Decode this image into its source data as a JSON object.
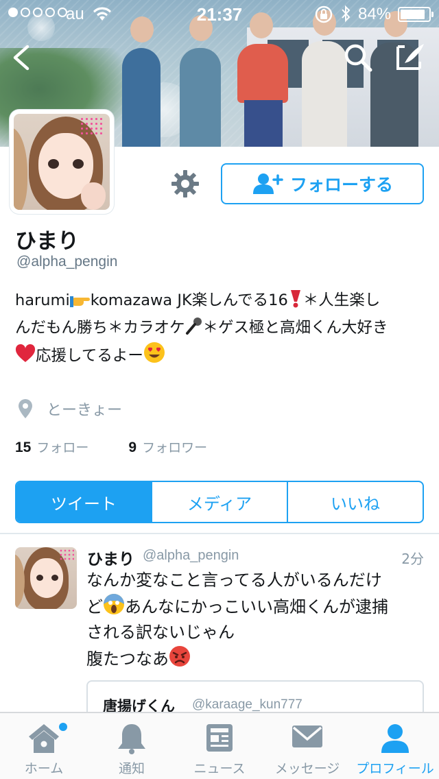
{
  "status_bar": {
    "carrier": "au",
    "time": "21:37",
    "battery_percent": "84%",
    "signal_bars_filled": 1,
    "signal_bars_total": 5,
    "battery_level": 0.84
  },
  "header_icons": [
    "back-icon",
    "search-icon",
    "compose-icon"
  ],
  "profile": {
    "display_name": "ひまり",
    "handle": "@alpha_pengin",
    "bio_line1": "harumi",
    "bio_line1b": "komazawa JK楽しんでる16",
    "bio_line1c": "＊人生楽し",
    "bio_line2": "んだもん勝ち＊カラオケ",
    "bio_line2b": "＊ゲス極と高畑くん大好き",
    "bio_line3": "応援してるよー",
    "location": "とーきょー",
    "following_count": "15",
    "following_label": "フォロー",
    "followers_count": "9",
    "followers_label": "フォロワー"
  },
  "actions": {
    "follow_label": "フォローする"
  },
  "tabs": [
    {
      "label": "ツイート",
      "active": true
    },
    {
      "label": "メディア",
      "active": false
    },
    {
      "label": "いいね",
      "active": false
    }
  ],
  "tweet": {
    "name": "ひまり",
    "handle": "@alpha_pengin",
    "time": "2分",
    "line1": "なんか変なこと言ってる人がいるんだけ",
    "line2a": "ど",
    "line2b": "あんなにかっこいい高畑くんが逮捕",
    "line3": "される訳ないじゃん",
    "line4": "腹たつなあ",
    "quote_name": "唐揚げくん",
    "quote_handle": "@karaage_kun777"
  },
  "tabbar": [
    {
      "label": "ホーム",
      "icon": "home-icon",
      "active": false
    },
    {
      "label": "通知",
      "icon": "bell-icon",
      "active": false
    },
    {
      "label": "ニュース",
      "icon": "news-icon",
      "active": false
    },
    {
      "label": "メッセージ",
      "icon": "message-icon",
      "active": false
    },
    {
      "label": "プロフィール",
      "icon": "profile-icon",
      "active": true
    }
  ],
  "colors": {
    "accent": "#1da1f2",
    "muted": "#8899a6",
    "text": "#14171a"
  }
}
